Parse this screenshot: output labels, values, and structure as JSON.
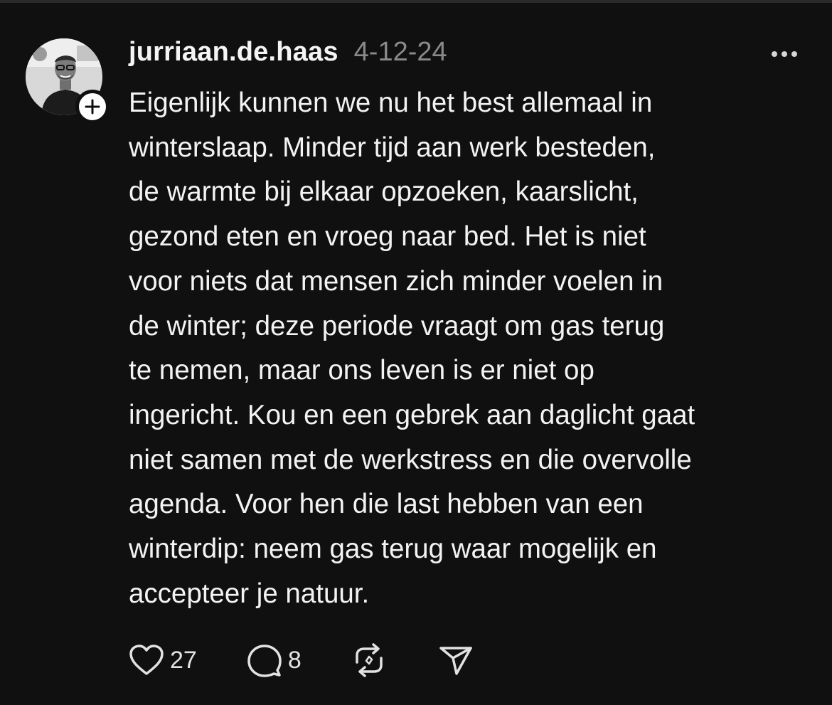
{
  "post": {
    "author": {
      "username": "jurriaan.de.haas",
      "avatar_icon": "person-photo"
    },
    "timestamp": "4-12-24",
    "text_lines": [
      "Eigenlijk kunnen we nu het best allemaal in",
      "winterslaap. Minder tijd aan werk besteden,",
      "de warmte bij elkaar opzoeken, kaarslicht,",
      "gezond eten en vroeg naar bed. Het is niet",
      "voor niets dat mensen zich minder voelen in",
      "de winter; deze periode vraagt om gas terug",
      "te nemen, maar ons leven is er niet op",
      "ingericht. Kou en een gebrek aan daglicht gaat",
      "niet samen met de werkstress en die overvolle",
      "agenda. Voor hen die last hebben van een",
      "winterdip: neem gas terug waar mogelijk en",
      "accepteer je natuur."
    ],
    "actions": {
      "like_count": "27",
      "reply_count": "8",
      "like_icon": "heart-icon",
      "reply_icon": "speech-bubble-icon",
      "repost_icon": "repost-icon",
      "share_icon": "paper-plane-icon",
      "more_icon": "ellipsis-icon",
      "follow_icon": "plus-icon"
    }
  },
  "colors": {
    "background": "#101010",
    "text": "#f3f3f3",
    "muted": "#8a8a8a",
    "icon": "#e2e2e2"
  }
}
